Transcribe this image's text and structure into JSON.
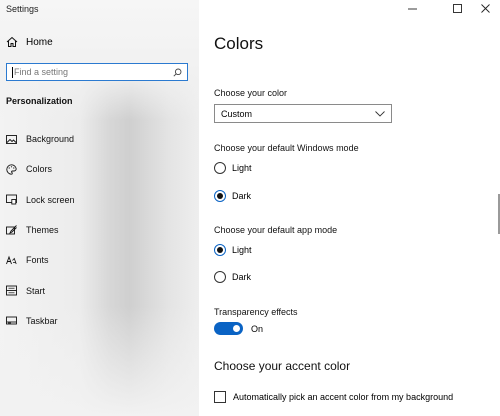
{
  "window": {
    "title": "Settings"
  },
  "sidebar": {
    "home_label": "Home",
    "search": {
      "placeholder": "Find a setting"
    },
    "section_header": "Personalization",
    "items": [
      {
        "label": "Background",
        "icon": "image-icon"
      },
      {
        "label": "Colors",
        "icon": "palette-icon"
      },
      {
        "label": "Lock screen",
        "icon": "lock-screen-icon"
      },
      {
        "label": "Themes",
        "icon": "brush-icon"
      },
      {
        "label": "Fonts",
        "icon": "font-icon"
      },
      {
        "label": "Start",
        "icon": "start-icon"
      },
      {
        "label": "Taskbar",
        "icon": "taskbar-icon"
      }
    ]
  },
  "main": {
    "title": "Colors",
    "choose_color": {
      "label": "Choose your color",
      "selected": "Custom"
    },
    "windows_mode": {
      "label": "Choose your default Windows mode",
      "options": [
        {
          "label": "Light",
          "checked": false
        },
        {
          "label": "Dark",
          "checked": true
        }
      ]
    },
    "app_mode": {
      "label": "Choose your default app mode",
      "options": [
        {
          "label": "Light",
          "checked": true
        },
        {
          "label": "Dark",
          "checked": false
        }
      ]
    },
    "transparency": {
      "label": "Transparency effects",
      "state_label": "On",
      "on": true
    },
    "accent": {
      "title": "Choose your accent color",
      "auto_pick_label": "Automatically pick an accent color from my background",
      "auto_pick_checked": false
    }
  },
  "colors": {
    "accent": "#0a63c4",
    "search_border": "#2b7ad0"
  }
}
